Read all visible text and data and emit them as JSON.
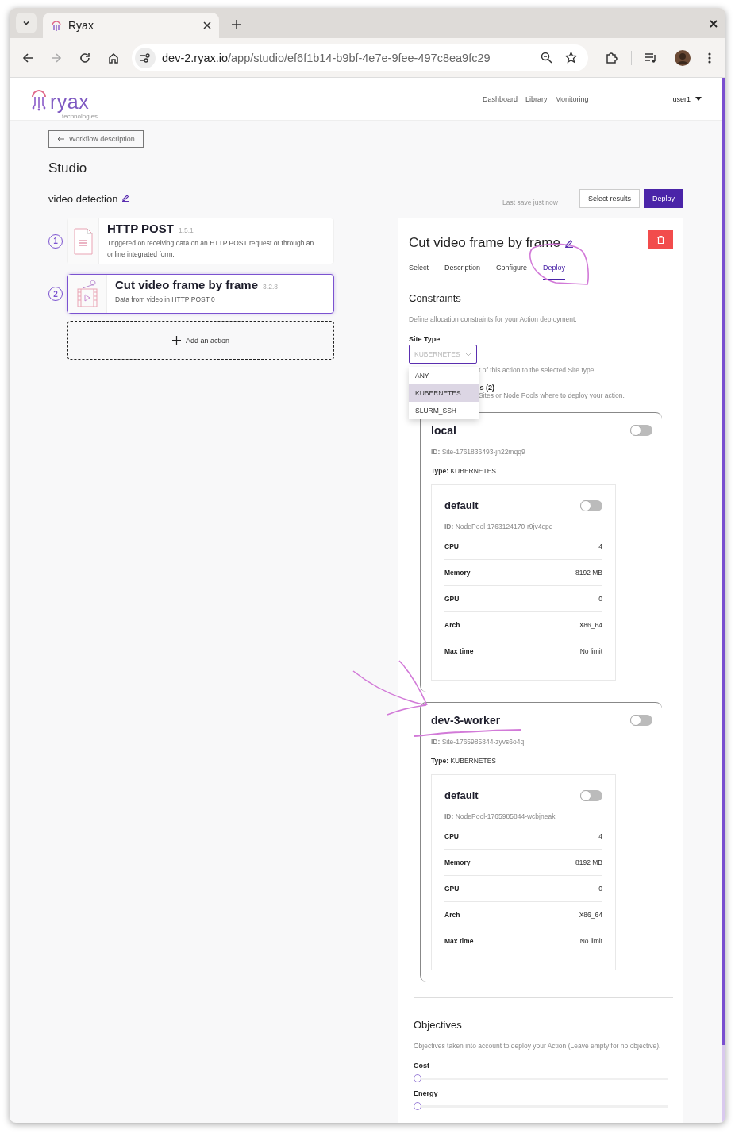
{
  "browser": {
    "tab_title": "Ryax",
    "url": {
      "host": "dev-2.ryax.io",
      "path": "/app/studio/ef6f1b14-b9bf-4e7e-9fee-497c8ea9fc29"
    }
  },
  "logo": {
    "name": "ryax",
    "tagline": "technologies"
  },
  "nav": {
    "links": [
      "Dashboard",
      "Library",
      "Monitoring"
    ],
    "user": "user1"
  },
  "back_button": "Workflow description",
  "page_title": "Studio",
  "workflow_name": "video detection",
  "save_status": "Last save just now",
  "buttons": [
    {
      "label": "Select results",
      "kind": "outline"
    },
    {
      "label": "Deploy",
      "kind": "primary"
    }
  ],
  "steps": [
    {
      "number": "1",
      "title": "HTTP POST",
      "version": "1.5.1",
      "description": "Triggered on receiving data on an HTTP POST request or through an online integrated form.",
      "kind": "file",
      "selected": false
    },
    {
      "number": "2",
      "title": "Cut video frame by frame",
      "version": "3.2.8",
      "description": "Data from video in HTTP POST 0",
      "kind": "video",
      "selected": true
    }
  ],
  "add_action": "Add an action",
  "panel": {
    "title": "Cut video frame by frame",
    "tabs": [
      {
        "label": "Select",
        "selected": false
      },
      {
        "label": "Description",
        "selected": false
      },
      {
        "label": "Configure",
        "selected": false
      },
      {
        "label": "Deploy",
        "selected": true
      }
    ],
    "constraints": {
      "heading": "Constraints",
      "description": "Define allocation constraints for your Action deployment.",
      "site_type_label": "Site Type",
      "site_type_value": "KUBERNETES",
      "site_type_hint": "t of this action to the selected Site type.",
      "sites_label": "ls (2)",
      "sites_hint": "Sites or Node Pools where to deploy your action.",
      "options": [
        {
          "label": "ANY",
          "selected": false
        },
        {
          "label": "KUBERNETES",
          "selected": true
        },
        {
          "label": "SLURM_SSH",
          "selected": false
        }
      ]
    },
    "sites": [
      {
        "name": "local",
        "on": false,
        "id_label": "ID:",
        "id": "Site-1761836493-jn22mqq9",
        "type_label": "Type:",
        "type": "KUBERNETES",
        "node_pools": [
          {
            "name": "default",
            "on": false,
            "id_label": "ID:",
            "id": "NodePool-1763124170-r9jv4epd",
            "specs": [
              {
                "label": "CPU",
                "value": "4"
              },
              {
                "label": "Memory",
                "value": "8192 MB"
              },
              {
                "label": "GPU",
                "value": "0"
              },
              {
                "label": "Arch",
                "value": "X86_64"
              },
              {
                "label": "Max time",
                "value": "No limit"
              }
            ]
          }
        ]
      },
      {
        "name": "dev-3-worker",
        "on": false,
        "id_label": "ID:",
        "id": "Site-1765985844-zyvs6o4q",
        "type_label": "Type:",
        "type": "KUBERNETES",
        "node_pools": [
          {
            "name": "default",
            "on": false,
            "id_label": "ID:",
            "id": "NodePool-1765985844-wcbjneak",
            "specs": [
              {
                "label": "CPU",
                "value": "4"
              },
              {
                "label": "Memory",
                "value": "8192 MB"
              },
              {
                "label": "GPU",
                "value": "0"
              },
              {
                "label": "Arch",
                "value": "X86_64"
              },
              {
                "label": "Max time",
                "value": "No limit"
              }
            ]
          }
        ]
      }
    ],
    "objectives": {
      "heading": "Objectives",
      "description": "Objectives taken into account to deploy your Action (Leave empty for no objective).",
      "sliders": [
        {
          "label": "Cost",
          "level": 0
        },
        {
          "label": "Energy",
          "level": 0
        }
      ]
    }
  }
}
